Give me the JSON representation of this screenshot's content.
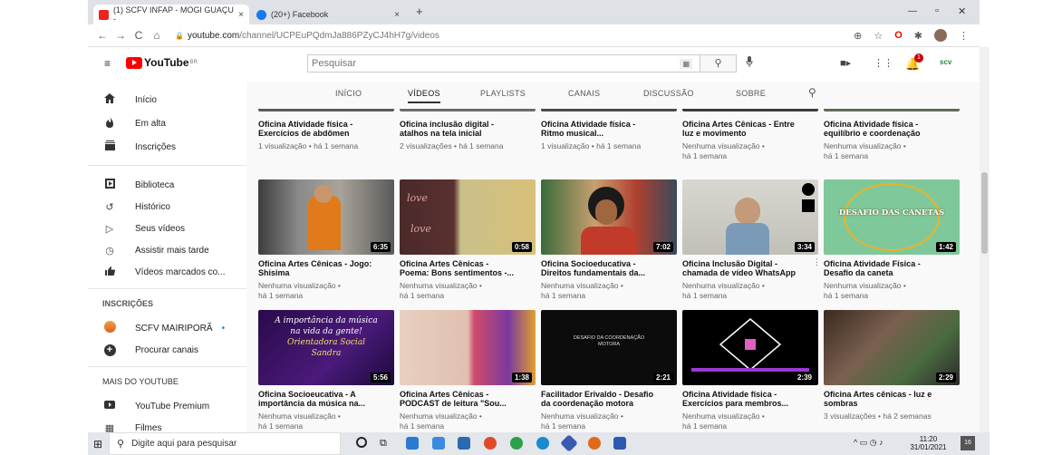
{
  "browser": {
    "tabs": [
      {
        "label": "(1) SCFV INFAP - MOGI GUAÇU -",
        "close": "×",
        "color": "#e22"
      },
      {
        "label": "(20+) Facebook",
        "close": "×",
        "color": "#1877f2"
      }
    ],
    "new_tab": "+",
    "window_controls": [
      "—",
      "▫",
      "✕"
    ],
    "url_host": "youtube.com",
    "url_path": "/channel/UCPEuPQdmJa886PZyCJ4hH7g/videos",
    "back": "←",
    "forward": "→",
    "reload": "C",
    "home": "⌂"
  },
  "masthead": {
    "menu_icon": "≡",
    "logo_text": "YouTube",
    "logo_region": "BR",
    "search_placeholder": "Pesquisar",
    "search_icon": "⚲",
    "mic_icon": "🎙",
    "notifications_count": "1",
    "account_label": "scv"
  },
  "sidebar": {
    "items": [
      {
        "label": "Início",
        "icon": "⌂"
      },
      {
        "label": "Em alta",
        "icon": "♨"
      },
      {
        "label": "Inscrições",
        "icon": "▤"
      },
      {
        "label": "Biblioteca",
        "icon": "▶"
      },
      {
        "label": "Histórico",
        "icon": "↺"
      },
      {
        "label": "Seus vídeos",
        "icon": "▷"
      },
      {
        "label": "Assistir mais tarde",
        "icon": "◷"
      },
      {
        "label": "Vídeos marcados co...",
        "icon": "👍"
      }
    ],
    "subs_heading": "INSCRIÇÕES",
    "subs": [
      {
        "label": "SCFV MAIRIPORÃ",
        "dot": "•"
      },
      {
        "label": "Procurar canais",
        "icon": "+"
      }
    ],
    "more_heading": "MAIS DO YOUTUBE",
    "more": [
      {
        "label": "YouTube Premium",
        "icon": "▶"
      },
      {
        "label": "Filmes",
        "icon": "▦"
      }
    ]
  },
  "channel_tabs": [
    "INÍCIO",
    "VÍDEOS",
    "PLAYLISTS",
    "CANAIS",
    "DISCUSSÃO",
    "SOBRE"
  ],
  "selected_tab": "VÍDEOS",
  "videos": [
    {
      "title1": "Oficina Atividade física -",
      "title2": "Exercícios de abdômen",
      "meta1": "1 visualização • há 1 semana",
      "meta2": ""
    },
    {
      "title1": "Oficina inclusão digital -",
      "title2": "atalhos na tela inicial",
      "meta1": "2 visualizações • há 1 semana",
      "meta2": ""
    },
    {
      "title1": "Oficina Atividade física -",
      "title2": "Ritmo musical...",
      "meta1": "1 visualização • há 1 semana",
      "meta2": ""
    },
    {
      "title1": "Oficina Artes Cênicas - Entre",
      "title2": "luz e movimento",
      "meta1": "Nenhuma visualização •",
      "meta2": "há 1 semana"
    },
    {
      "title1": "Oficina Atividade física -",
      "title2": "equilíbrio e coordenação",
      "meta1": "Nenhuma visualização •",
      "meta2": "há 1 semana"
    },
    {
      "title1": "Oficina Artes Cênicas - Jogo:",
      "title2": "Shisima",
      "meta1": "Nenhuma visualização •",
      "meta2": "há 1 semana",
      "duration": "6:35"
    },
    {
      "title1": "Oficina Artes Cênicas -",
      "title2": "Poema: Bons sentimentos -...",
      "meta1": "Nenhuma visualização •",
      "meta2": "há 1 semana",
      "duration": "0:58"
    },
    {
      "title1": "Oficina Socioeducativa -",
      "title2": "Direitos fundamentais da...",
      "meta1": "Nenhuma visualização •",
      "meta2": "há 1 semana",
      "duration": "7:02"
    },
    {
      "title1": "Oficina Inclusão Digital -",
      "title2": "chamada de vídeo WhatsApp",
      "meta1": "Nenhuma visualização •",
      "meta2": "há 1 semana",
      "duration": "3:34"
    },
    {
      "title1": "Oficina Atividade Física -",
      "title2": "Desafio da caneta",
      "meta1": "Nenhuma visualização •",
      "meta2": "há 1 semana",
      "duration": "1:42"
    },
    {
      "title1": "Oficina Socioeucativa - A",
      "title2": "importância da música na...",
      "meta1": "Nenhuma visualização •",
      "meta2": "há 1 semana",
      "duration": "5:56"
    },
    {
      "title1": "Oficina Artes Cênicas -",
      "title2": "PODCAST de leitura \"Sou...",
      "meta1": "Nenhuma visualização •",
      "meta2": "há 1 semana",
      "duration": "1:38"
    },
    {
      "title1": "Facilitador Erivaldo - Desafio",
      "title2": "da coordenação motora",
      "meta1": "Nenhuma visualização •",
      "meta2": "há 1 semana",
      "duration": "2:21"
    },
    {
      "title1": "Oficina Atividade física -",
      "title2": "Exercícios para membros...",
      "meta1": "Nenhuma visualização •",
      "meta2": "há 1 semana",
      "duration": "2:39"
    },
    {
      "title1": "Oficina Artes cênicas - luz e",
      "title2": "sombras",
      "meta1": "3 visualizações • há 2 semanas",
      "meta2": "",
      "duration": "2:29"
    }
  ],
  "thumb_text": {
    "desafio": "DESAFIO DAS CANETAS",
    "musica1": "A importância da música",
    "musica2": "na vida da gente!",
    "musica3": "Orientadora Social",
    "musica4": "Sandra",
    "coord1": "DESAFIO DA COORDENAÇÃO",
    "coord2": "MOTORA",
    "love": "love"
  },
  "taskbar": {
    "start_icon": "⊞",
    "search_placeholder": "Digite aqui para pesquisar",
    "time": "11:20",
    "date": "31/01/2021",
    "notif_count": "16"
  }
}
